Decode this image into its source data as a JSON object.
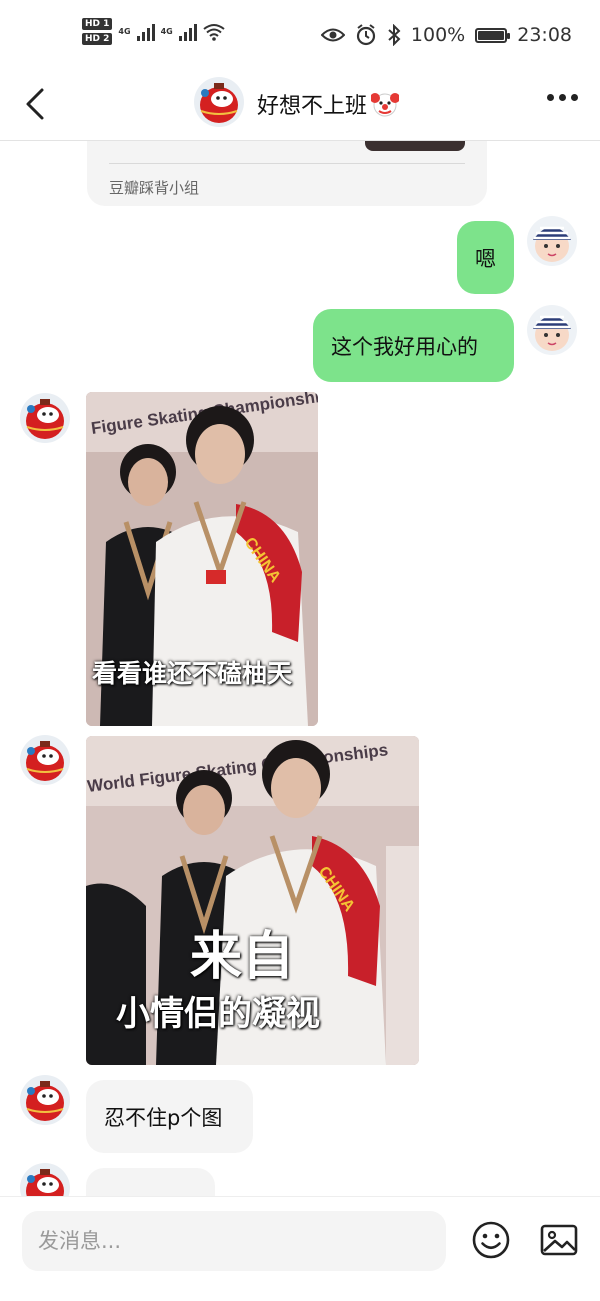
{
  "status_bar": {
    "hd1": "HD",
    "hd1_num": "1",
    "hd2": "HD",
    "hd2_num": "2",
    "net1": "4G",
    "net2": "4G",
    "battery_percent": "100%",
    "battery_level": 1.0,
    "time": "23:08",
    "icons": [
      "eye-icon",
      "alarm-icon",
      "bluetooth-icon",
      "battery-icon",
      "wifi-icon",
      "signal-icon"
    ]
  },
  "header": {
    "title": "好想不上班",
    "title_emoji": "clown-face-icon",
    "back_icon": "chevron-left-icon",
    "more_icon": "more-dots-icon"
  },
  "share_card": {
    "group_name": "豆瓣踩背小组"
  },
  "messages": [
    {
      "side": "sent",
      "type": "text",
      "text": "嗯"
    },
    {
      "side": "sent",
      "type": "text",
      "text": "这个我好用心的"
    },
    {
      "side": "recv",
      "type": "sticker",
      "caption": "看看谁还不磕柚天",
      "banner": "Figure Skating Championships"
    },
    {
      "side": "recv",
      "type": "sticker",
      "caption_big": "来自",
      "caption_small": "小情侣的凝视",
      "banner": "World Figure Skating Championships"
    },
    {
      "side": "recv",
      "type": "text",
      "text": "忍不住p个图"
    },
    {
      "side": "recv",
      "type": "text",
      "text": ""
    }
  ],
  "input": {
    "placeholder": "发消息..."
  },
  "colors": {
    "sent_bubble": "#7de38b",
    "recv_bubble": "#f4f4f4",
    "background": "#ffffff"
  }
}
